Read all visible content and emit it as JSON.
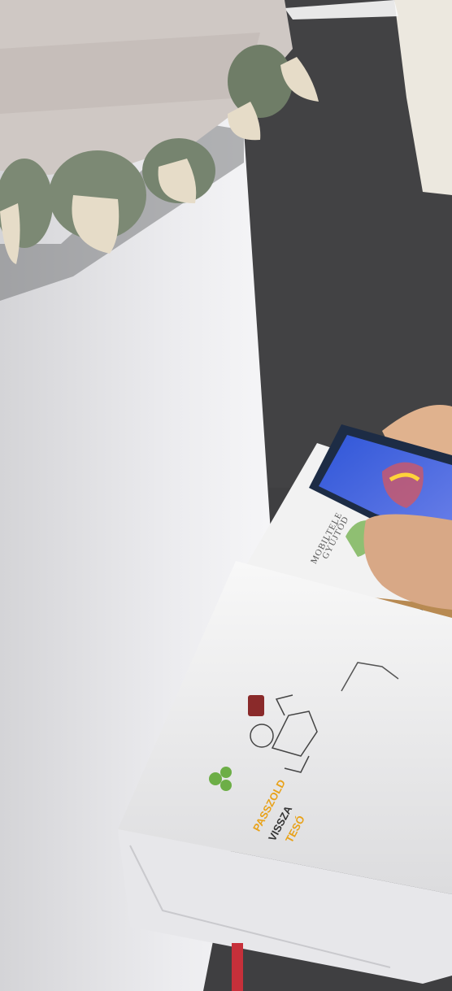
{
  "scene": {
    "box_label": {
      "line1": "MOBILTELE",
      "line2": "GYŰJTŐD"
    },
    "logo_text": {
      "line1": "PASSZOLD",
      "line2": "VISSZA",
      "line3": "TESÓ"
    }
  },
  "colors": {
    "floor": "#3f3f41",
    "wall": "#e6e6e8",
    "box": "#f4f4f4",
    "cardboard": "#b88a52",
    "recycle_green": "#6dae47",
    "logo_orange": "#e8a21a",
    "phone_body": "#1d2c45",
    "phone_screen": "#3a5bd0",
    "skin": "#e0b28e"
  }
}
